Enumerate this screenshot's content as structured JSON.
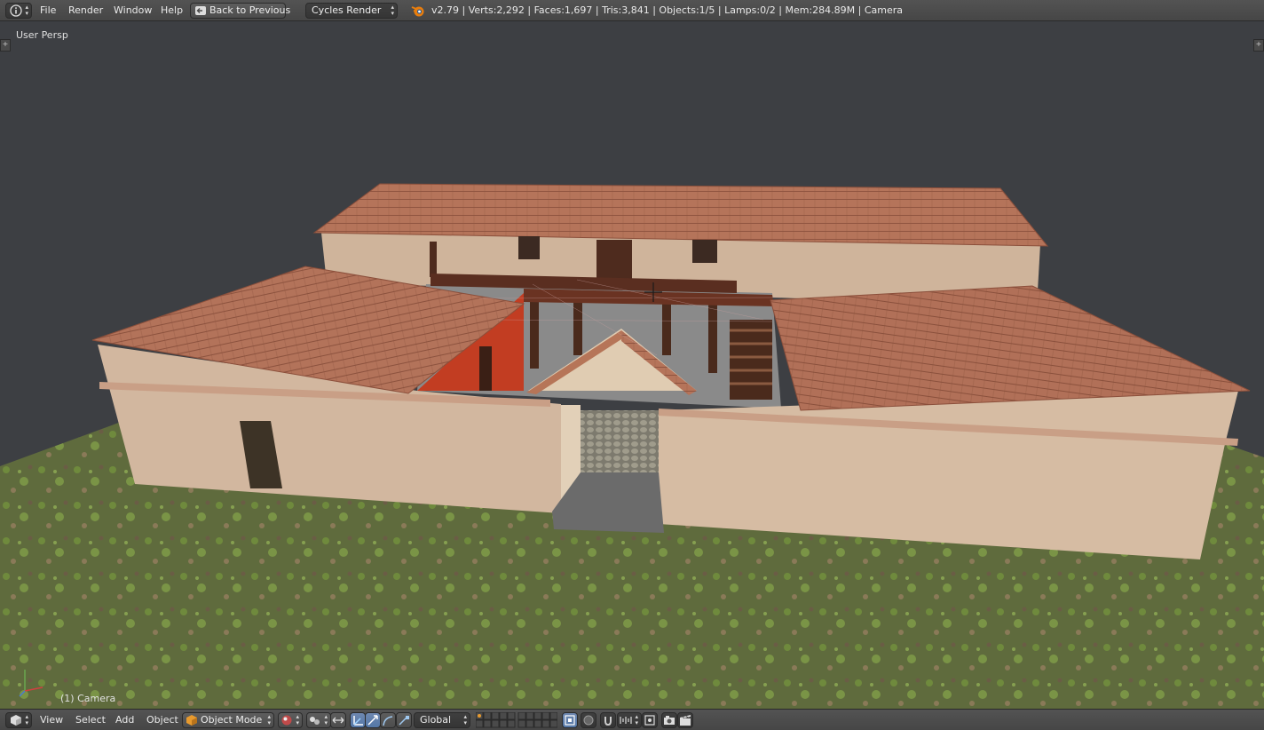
{
  "header": {
    "menu": [
      "File",
      "Render",
      "Window",
      "Help"
    ],
    "back_button": "Back to Previous",
    "render_engine": "Cycles Render",
    "stats": "v2.79 | Verts:2,292 | Faces:1,697 | Tris:3,841 | Objects:1/5 | Lamps:0/2 | Mem:284.89M | Camera"
  },
  "viewport": {
    "view_label": "User Persp",
    "object_label": "(1) Camera"
  },
  "footer": {
    "menu": [
      "View",
      "Select",
      "Add",
      "Object"
    ],
    "mode": "Object Mode",
    "orientation": "Global"
  },
  "colors": {
    "accent_blue": "#5478a7",
    "roof": "#b4735a",
    "wall": "#d4b9a0",
    "ground": "#5e6a3c",
    "background": "#3d3f43"
  },
  "icons": [
    "info-icon",
    "back-icon",
    "blender-logo-icon",
    "cube-icon",
    "shading-sphere-icon",
    "pivot-icon",
    "manipulator-icon",
    "translate-icon",
    "rotate-icon",
    "scale-icon",
    "layers-icon",
    "lock-icon",
    "snap-magnet-icon",
    "proportional-icon",
    "render-icon",
    "clapboard-icon",
    "axis-gizmo-icon"
  ]
}
